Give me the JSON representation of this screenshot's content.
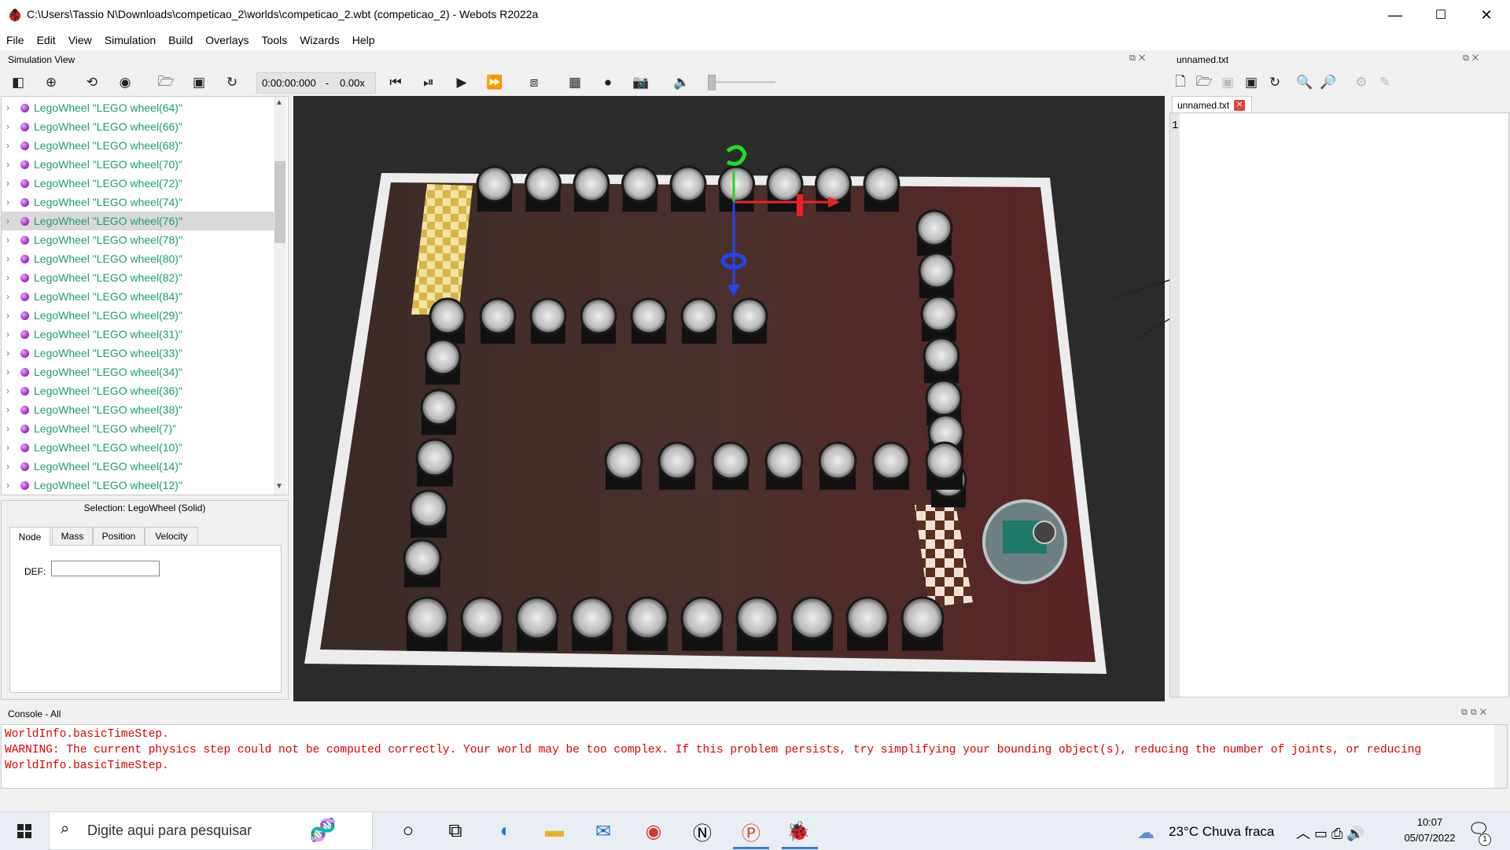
{
  "window": {
    "title": "C:\\Users\\Tassio N\\Downloads\\competicao_2\\worlds\\competicao_2.wbt (competicao_2) - Webots R2022a",
    "controls": [
      "—",
      "☐",
      "✕"
    ]
  },
  "menu": [
    "File",
    "Edit",
    "View",
    "Simulation",
    "Build",
    "Overlays",
    "Tools",
    "Wizards",
    "Help"
  ],
  "simulation_view": {
    "title": "Simulation View",
    "time": "0:00:00:000",
    "separator": "-",
    "speed": "0.00x"
  },
  "scene_tree": {
    "items": [
      "LegoWheel \"LEGO wheel(64)\"",
      "LegoWheel \"LEGO wheel(66)\"",
      "LegoWheel \"LEGO wheel(68)\"",
      "LegoWheel \"LEGO wheel(70)\"",
      "LegoWheel \"LEGO wheel(72)\"",
      "LegoWheel \"LEGO wheel(74)\"",
      "LegoWheel \"LEGO wheel(76)\"",
      "LegoWheel \"LEGO wheel(78)\"",
      "LegoWheel \"LEGO wheel(80)\"",
      "LegoWheel \"LEGO wheel(82)\"",
      "LegoWheel \"LEGO wheel(84)\"",
      "LegoWheel \"LEGO wheel(29)\"",
      "LegoWheel \"LEGO wheel(31)\"",
      "LegoWheel \"LEGO wheel(33)\"",
      "LegoWheel \"LEGO wheel(34)\"",
      "LegoWheel \"LEGO wheel(36)\"",
      "LegoWheel \"LEGO wheel(38)\"",
      "LegoWheel \"LEGO wheel(7)\"",
      "LegoWheel \"LEGO wheel(10)\"",
      "LegoWheel \"LEGO wheel(14)\"",
      "LegoWheel \"LEGO wheel(12)\""
    ],
    "selected_index": 6
  },
  "selection": {
    "title": "Selection: LegoWheel (Solid)",
    "tabs": [
      "Node",
      "Mass",
      "Position",
      "Velocity"
    ],
    "def_label": "DEF:",
    "def_value": ""
  },
  "editor": {
    "title": "unnamed.txt",
    "tab": "unnamed.txt",
    "line_number": "1"
  },
  "console": {
    "title": "Console - All",
    "lines": [
      "WorldInfo.basicTimeStep.",
      "WARNING: The current physics step could not be computed correctly. Your world may be too complex. If this problem persists, try simplifying your bounding object(s), reducing the number of joints, or reducing",
      "WorldInfo.basicTimeStep."
    ]
  },
  "taskbar": {
    "search_placeholder": "Digite aqui para pesquisar",
    "weather": "23°C  Chuva fraca",
    "time": "10:07",
    "date": "05/07/2022",
    "notification_count": "1"
  }
}
